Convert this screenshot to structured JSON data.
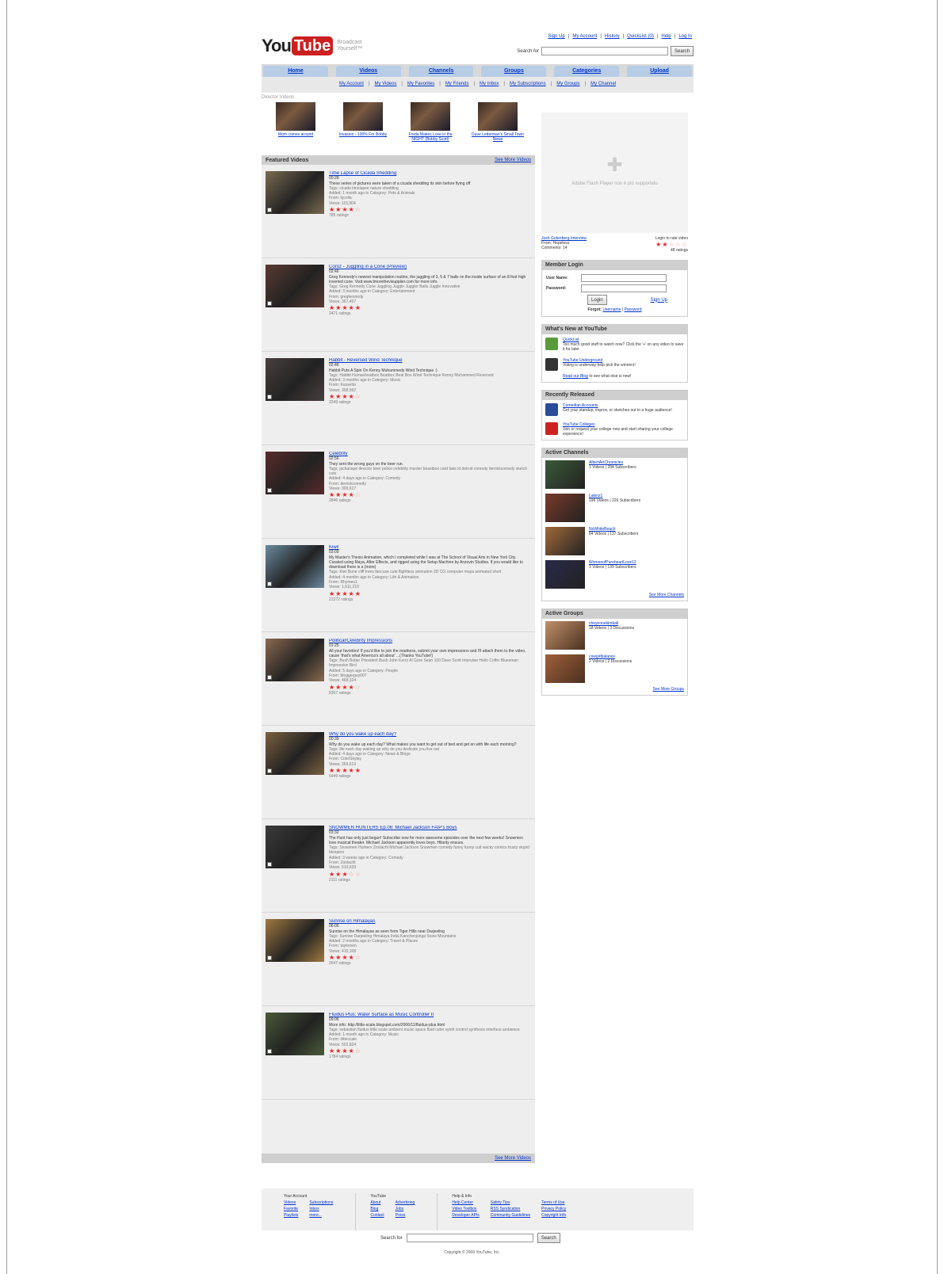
{
  "header": {
    "logo_you": "You",
    "logo_tube": "Tube",
    "tagline": "Broadcast Yourself™",
    "top_links": [
      "Sign Up",
      "My Account",
      "History",
      "QuickList (0)",
      "Help",
      "Log In"
    ],
    "search_label": "Search for",
    "search_button": "Search"
  },
  "nav": {
    "tabs": [
      "Home",
      "Videos",
      "Channels",
      "Groups",
      "Categories",
      "Upload"
    ],
    "subtabs": [
      "My Account",
      "My Videos",
      "My Favorites",
      "My Friends",
      "My Inbox",
      "My Subscriptions",
      "My Groups",
      "My Channel"
    ]
  },
  "director": {
    "label": "Director Videos",
    "videos": [
      {
        "title": "Mom comes around"
      },
      {
        "title": "Invasion - 100% For Bobby"
      },
      {
        "title": "Freda Makes Love in the NIGHT (Bobby Scott)"
      },
      {
        "title": "Dave Letterman's Small Town News"
      }
    ]
  },
  "featured": {
    "title": "Featured Videos",
    "see_more": "See More Videos",
    "see_more_bottom": "See More Videos",
    "videos": [
      {
        "title": "Time Lapse of Cicada Shedding",
        "duration": "00:28",
        "desc": "These series of pictures were taken of a cicada shedding its skin before flying off",
        "tags": "Tags: cicada  timelapse  nature  shedding",
        "added": "Added: 1 month ago  in Category: Pets & Animals",
        "from": "From: bjcolla",
        "views": "Views: 115,904",
        "stars": 3.5,
        "ratings": "785 ratings",
        "thumb": "#7a6a50"
      },
      {
        "title": "Coroz - Juggling in a Cone (Preview)",
        "duration": "02:46",
        "desc": "Greg Kennedy's newest manipulation routine, the juggling of 3, 5 & 7 balls on the inside surface of an 8 foot high inverted cone. Visit www.tmorethevisupplier.com for more info.",
        "tags": "Tags: Greg  Kennedy  Cone  Juggling  Juggle  Juggler  Balls  Juggle  Innovative",
        "added": "Added: 3 months ago  in Category: Entertainment",
        "from": "From: gregkennedy",
        "views": "Views: 367,457",
        "stars": 5,
        "ratings": "2471 ratings",
        "thumb": "#5a3a30"
      },
      {
        "title": "Habbit - Reversed Wind Technique",
        "duration": "02:46",
        "desc": "Habbit Puts A Spin On Kenny Muhammeds Wind Technique :)",
        "tags": "Tags: Habbit  Humanbeatbox  Beatbox  Beat  Box  Wind  Technique  Kenny  Muhammed  Reversed",
        "added": "Added: 3 months ago  in Category: Music",
        "from": "From: Kussetta",
        "views": "Views: 308,992",
        "stars": 3.5,
        "ratings": "2249 ratings",
        "thumb": "#4a4040"
      },
      {
        "title": "Celebrity",
        "duration": "02:56",
        "desc": "They sent the wrong guys on the beer run.",
        "tags": "Tags: jackanape  director  beer  police  celebrity  murder  beastbox  card  fake  id  detroit  comedy  derrickcomedy  sketch  cute",
        "added": "Added: 4 days ago  in Category: Comedy",
        "from": "From: derrickcomedy",
        "views": "Views: 309,617",
        "stars": 3.5,
        "ratings": "2846 ratings",
        "thumb": "#5a2a2a"
      },
      {
        "title": "Kiwi!",
        "duration": "03:09",
        "desc": "My Master's Thesis Animation, which I completed while I was at The School of Visual Arts in New York City. Created using Maya, After Effects, and rigged using the Setup Machine by Anzovin Studios. If you would like to download there is a (more)",
        "tags": "Tags: Kiwi  Bone  cliff  trees  fancuse  cute  flightless  animation  3D  CG  computer  maya  animated  short",
        "added": "Added: 4 months ago  in Category: Life & Animation",
        "from": "From: Rhymeo1",
        "views": "Views: 1,611,210",
        "stars": 5,
        "ratings": "21272 ratings",
        "thumb": "#6a8aa0"
      },
      {
        "title": "Political/Celebrity Impressions",
        "duration": "01:25",
        "desc": "All your favorites! If you'd like to join the madness, submit your own impressions and I'll attach them to the video, cause 'that's what America's all about' ...(Thanks YouTube!)",
        "tags": "Tags: Bush  Butler  President  Bush  John  Kerry  Al  Gore  Sean  100  Dave  Scott  Interview  Hello  Coffin  Bluesman  Impression  Bird",
        "added": "Added: 5 days ago  in Category: People",
        "from": "From: bloggerguy007",
        "views": "Views: 468,324",
        "stars": 3.5,
        "ratings": "5367 ratings",
        "thumb": "#8a6a50"
      },
      {
        "title": "Why do you wake up each day?",
        "duration": "00:39",
        "desc": "Why do you wake up each day? What makes you want to get out of bed and get on with life each morning?",
        "tags": "Tags: life  each  day  waking  up  why  do  you  dedicate  you  live  oat",
        "added": "Added: 4 days ago  in Category: News & Blogs",
        "from": "From: Cole/Skylay",
        "views": "Views: 369,613",
        "stars": 5,
        "ratings": "5449 ratings",
        "thumb": "#7a6040"
      },
      {
        "title": "SNOWMEN HUNTERS Ep.06: Michael Jackson FAIP's Boys",
        "duration": "03:32",
        "desc": "The Hunt has only just begun! Subscribe now for more awesome episodes over the next few weeks! Snowmen love musical theater. Michael Jackson apparently loves boys. Hilarity ensues.",
        "tags": "Tags: Snowmen  Hunters  Zoolacht  Michael  Jackson  Snowmen  comedy  funny  funny  cult  wacky  comics  trusty  stupid  bloopers",
        "added": "Added: 3 weeks ago  in Category: Comedy",
        "from": "From: Zoolacht",
        "views": "Views: 510,639",
        "stars": 2.5,
        "ratings": "2111 ratings",
        "thumb": "#3a3a3a"
      },
      {
        "title": "Sunrise on Himalayas",
        "duration": "06:06",
        "desc": "Sunrise on the Himalayas as seen from Tiger Hills near Darjeeling",
        "tags": "Tags: Sunrise  Darjeeling  Himalaya  India  Kanchenjunga  Snow  Mountains",
        "added": "Added: 2 months ago  in Category: Travel & Places",
        "from": "From: taylorsen",
        "views": "Views: 415,108",
        "stars": 3.5,
        "ratings": "2647 ratings",
        "thumb": "#a07a40"
      },
      {
        "title": "Fluidus Plus: Water Surface as Music Controller II",
        "duration": "09:06",
        "desc": "More info: http://little-scale.blogspot.com/2006/11/fluidus-plus.html",
        "tags": "Tags: sebastian  fluidus  little  scale  ambient  music  space  fluid  cube  synth  control  synthesis  interface  ambience",
        "added": "Added: 1 month ago  in Category: Music",
        "from": "From: littlescale",
        "views": "Views: 502,824",
        "stars": 3.5,
        "ratings": "1784 ratings",
        "thumb": "#4a5a3a"
      }
    ]
  },
  "right": {
    "flash_msg": "Adobe Flash Player non è più supportato",
    "video_title": "Josh Gutenberg Interview",
    "video_from": "From: Hopeless",
    "video_comments": "Comments: 14",
    "rate_label": "Login to rate video",
    "rate_count": "48 ratings",
    "login": {
      "title": "Member Login",
      "user_label": "User Name:",
      "pass_label": "Password:",
      "button": "Login",
      "signup": "Sign Up",
      "forgot": "Forgot:",
      "forgot_user": "Username",
      "forgot_pass": "Password"
    },
    "whats_new": {
      "title": "What's New at YouTube",
      "items": [
        {
          "title": "QuickList",
          "text": "Too much good stuff to watch now? Click the '+' on any video to save it for later."
        },
        {
          "title": "YouTube Underground",
          "text": "Voting is underway-help pick the winners!"
        }
      ],
      "blog_link": "Read our Blog",
      "blog_text": "to see what else is new!"
    },
    "recent": {
      "title": "Recently Released",
      "items": [
        {
          "title": "Comedian Accounts",
          "text": "Get your standup, improv, or sketches out to a huge audience!"
        },
        {
          "title": "YouTube Colleges",
          "text": "Join or request your college now and start sharing your college experience!"
        }
      ]
    },
    "channels": {
      "title": "Active Channels",
      "items": [
        {
          "name": "AlbertArtChronicles",
          "stats": "1 Videos | 284 Subscribers"
        },
        {
          "name": "Lakinz1",
          "stats": "196 Videos | 226 Subscribers"
        },
        {
          "name": "NoWhiteBeach",
          "stats": "84 Videos | 137 Subscribers"
        },
        {
          "name": "WomenofPureheartLove12",
          "stats": "3 Videos | 139 Subscribers"
        }
      ],
      "more": "See More Channels"
    },
    "groups": {
      "title": "Active Groups",
      "items": [
        {
          "name": "cheyennekimball",
          "stats": "18 Videos | 3 Discussions"
        },
        {
          "name": "cowgirlbalance",
          "stats": "2 Videos | 2 Discussions"
        }
      ],
      "more": "See More Groups"
    }
  },
  "footer": {
    "col1_title": "Your Account",
    "col1_links": [
      "Videos",
      "Favorite",
      "Playlists",
      "Subscriptions",
      "Inbox",
      "more..."
    ],
    "col2_title": "YouTube",
    "col2_links": [
      "About",
      "Blog",
      "Contact",
      "Advertising",
      "Jobs",
      "Press"
    ],
    "col3_title": "Help & Info",
    "col3_links": [
      "Help Center",
      "Video Toolbox",
      "Developer APIs",
      "Safety Tips",
      "RSS Syndication",
      "Community Guidelines",
      "Terms of Use",
      "Privacy Policy",
      "Copyright Info"
    ],
    "search_label": "Search for",
    "search_button": "Search",
    "copyright": "Copyright © 2006 YouTube, Inc."
  }
}
